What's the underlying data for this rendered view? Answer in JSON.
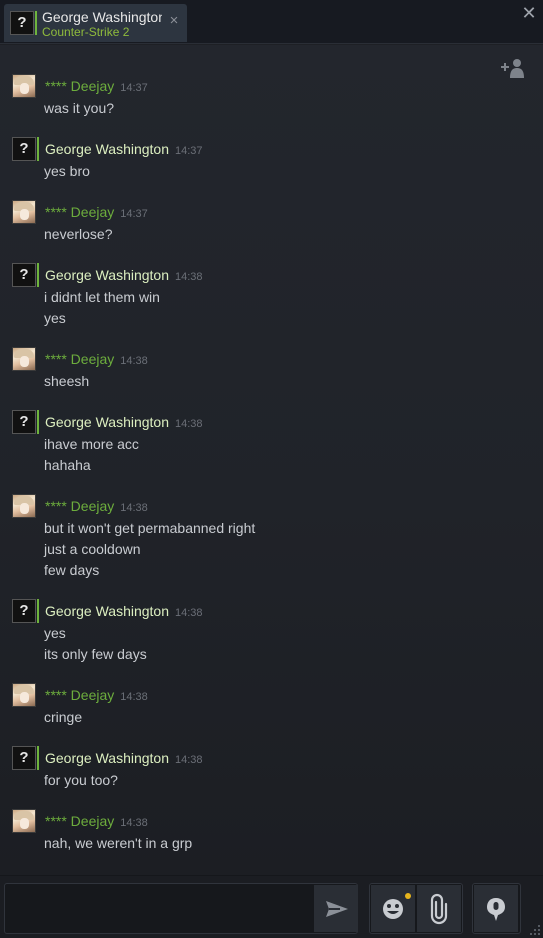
{
  "tab": {
    "avatar_glyph": "?",
    "name": "George Washington",
    "game": "Counter-Strike 2",
    "close_glyph": "×"
  },
  "window": {
    "close_glyph": "✕"
  },
  "chat": {
    "messages": [
      {
        "sender": "**** Deejay",
        "time": "14:37",
        "lines": [
          "was it you?"
        ]
      },
      {
        "sender": "George Washington",
        "time": "14:37",
        "lines": [
          "yes bro"
        ]
      },
      {
        "sender": "**** Deejay",
        "time": "14:37",
        "lines": [
          "neverlose?"
        ]
      },
      {
        "sender": "George Washington",
        "time": "14:38",
        "lines": [
          "i didnt let them win",
          "yes"
        ]
      },
      {
        "sender": "**** Deejay",
        "time": "14:38",
        "lines": [
          "sheesh"
        ]
      },
      {
        "sender": "George Washington",
        "time": "14:38",
        "lines": [
          "ihave more acc",
          "hahaha"
        ]
      },
      {
        "sender": "**** Deejay",
        "time": "14:38",
        "lines": [
          "but it won't get permabanned right",
          "just a cooldown",
          "few days"
        ]
      },
      {
        "sender": "George Washington",
        "time": "14:38",
        "lines": [
          "yes",
          "its only few days"
        ]
      },
      {
        "sender": "**** Deejay",
        "time": "14:38",
        "lines": [
          "cringe"
        ]
      },
      {
        "sender": "George Washington",
        "time": "14:38",
        "lines": [
          "for you too?"
        ]
      },
      {
        "sender": "**** Deejay",
        "time": "14:38",
        "lines": [
          "nah, we weren't in a grp"
        ]
      }
    ]
  },
  "input": {
    "value": "",
    "placeholder": ""
  },
  "icons": {
    "add_friend": "add-friend-icon",
    "send": "send-arrow-icon",
    "emoji": "emoticon-icon",
    "attach": "paperclip-icon",
    "voice": "voice-chat-icon"
  },
  "colors": {
    "friend_name": "#6dad3d",
    "self_name": "#dcefc0",
    "game_status": "#8fbb3c",
    "notification_dot": "#e7b51d"
  }
}
